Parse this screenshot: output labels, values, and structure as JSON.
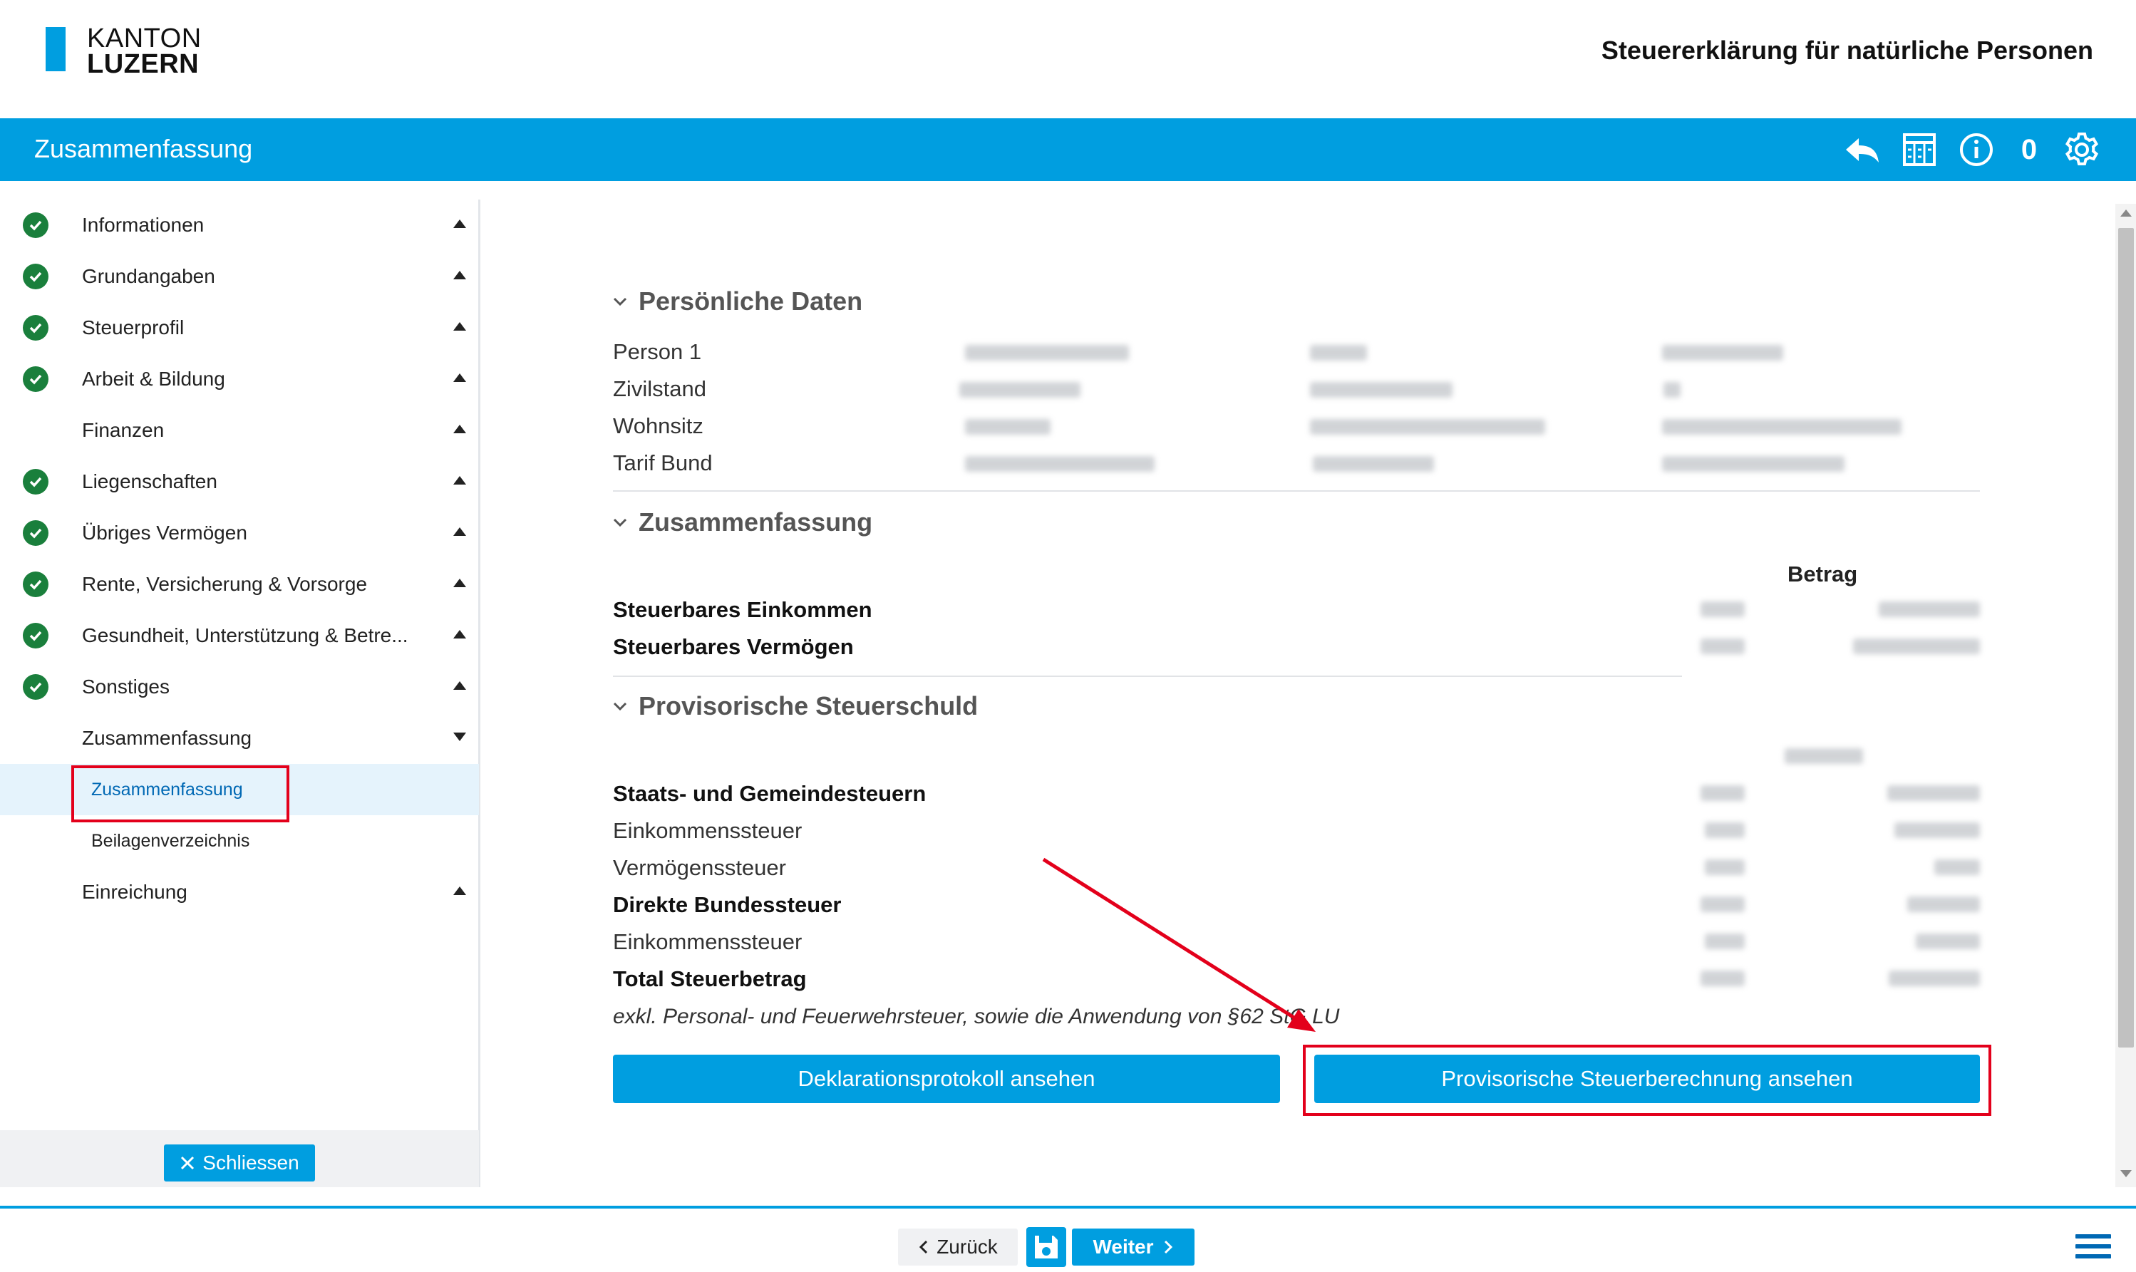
{
  "header": {
    "logo_line1": "KANTON",
    "logo_line2": "LUZERN",
    "app_title": "Steuererklärung für natürliche Personen"
  },
  "section_bar": {
    "title": "Zusammenfassung",
    "icons": [
      "back-arrow-icon",
      "calculator-icon",
      "info-icon",
      "gear-icon"
    ],
    "count": "0"
  },
  "sidebar": {
    "items": [
      {
        "label": "Informationen",
        "done": true
      },
      {
        "label": "Grundangaben",
        "done": true
      },
      {
        "label": "Steuerprofil",
        "done": true
      },
      {
        "label": "Arbeit & Bildung",
        "done": true
      },
      {
        "label": "Finanzen",
        "done": false
      },
      {
        "label": "Liegenschaften",
        "done": true
      },
      {
        "label": "Übriges Vermögen",
        "done": true
      },
      {
        "label": "Rente, Versicherung & Vorsorge",
        "done": true
      },
      {
        "label": "Gesundheit, Unterstützung & Betre...",
        "done": true
      },
      {
        "label": "Sonstiges",
        "done": true
      },
      {
        "label": "Zusammenfassung",
        "done": false,
        "expanded": true
      },
      {
        "label": "Einreichung",
        "done": false
      }
    ],
    "subitems": [
      {
        "label": "Zusammenfassung",
        "active": true
      },
      {
        "label": "Beilagenverzeichnis",
        "active": false
      }
    ],
    "close_label": "Schliessen"
  },
  "main": {
    "personal": {
      "title": "Persönliche Daten",
      "rows": [
        "Person 1",
        "Zivilstand",
        "Wohnsitz",
        "Tarif Bund"
      ]
    },
    "summary": {
      "title": "Zusammenfassung",
      "betrag_header": "Betrag",
      "rows": [
        "Steuerbares Einkommen",
        "Steuerbares Vermögen"
      ]
    },
    "tax": {
      "title": "Provisorische Steuerschuld",
      "rows": [
        {
          "label": "Staats- und Gemeindesteuern",
          "bold": true
        },
        {
          "label": "Einkommenssteuer",
          "bold": false
        },
        {
          "label": "Vermögenssteuer",
          "bold": false
        },
        {
          "label": "Direkte Bundessteuer",
          "bold": true
        },
        {
          "label": "Einkommenssteuer",
          "bold": false
        },
        {
          "label": "Total Steuerbetrag",
          "bold": true
        }
      ],
      "note": "exkl. Personal- und Feuerwehrsteuer, sowie die Anwendung von §62 StG LU"
    },
    "buttons": {
      "protocol": "Deklarationsprotokoll ansehen",
      "calculation": "Provisorische Steuerberechnung ansehen"
    }
  },
  "footer": {
    "back_label": "Zurück",
    "next_label": "Weiter"
  },
  "colors": {
    "brand_blue": "#009ee0",
    "check_green": "#1a7f3c",
    "highlight_red": "#e3001b"
  }
}
